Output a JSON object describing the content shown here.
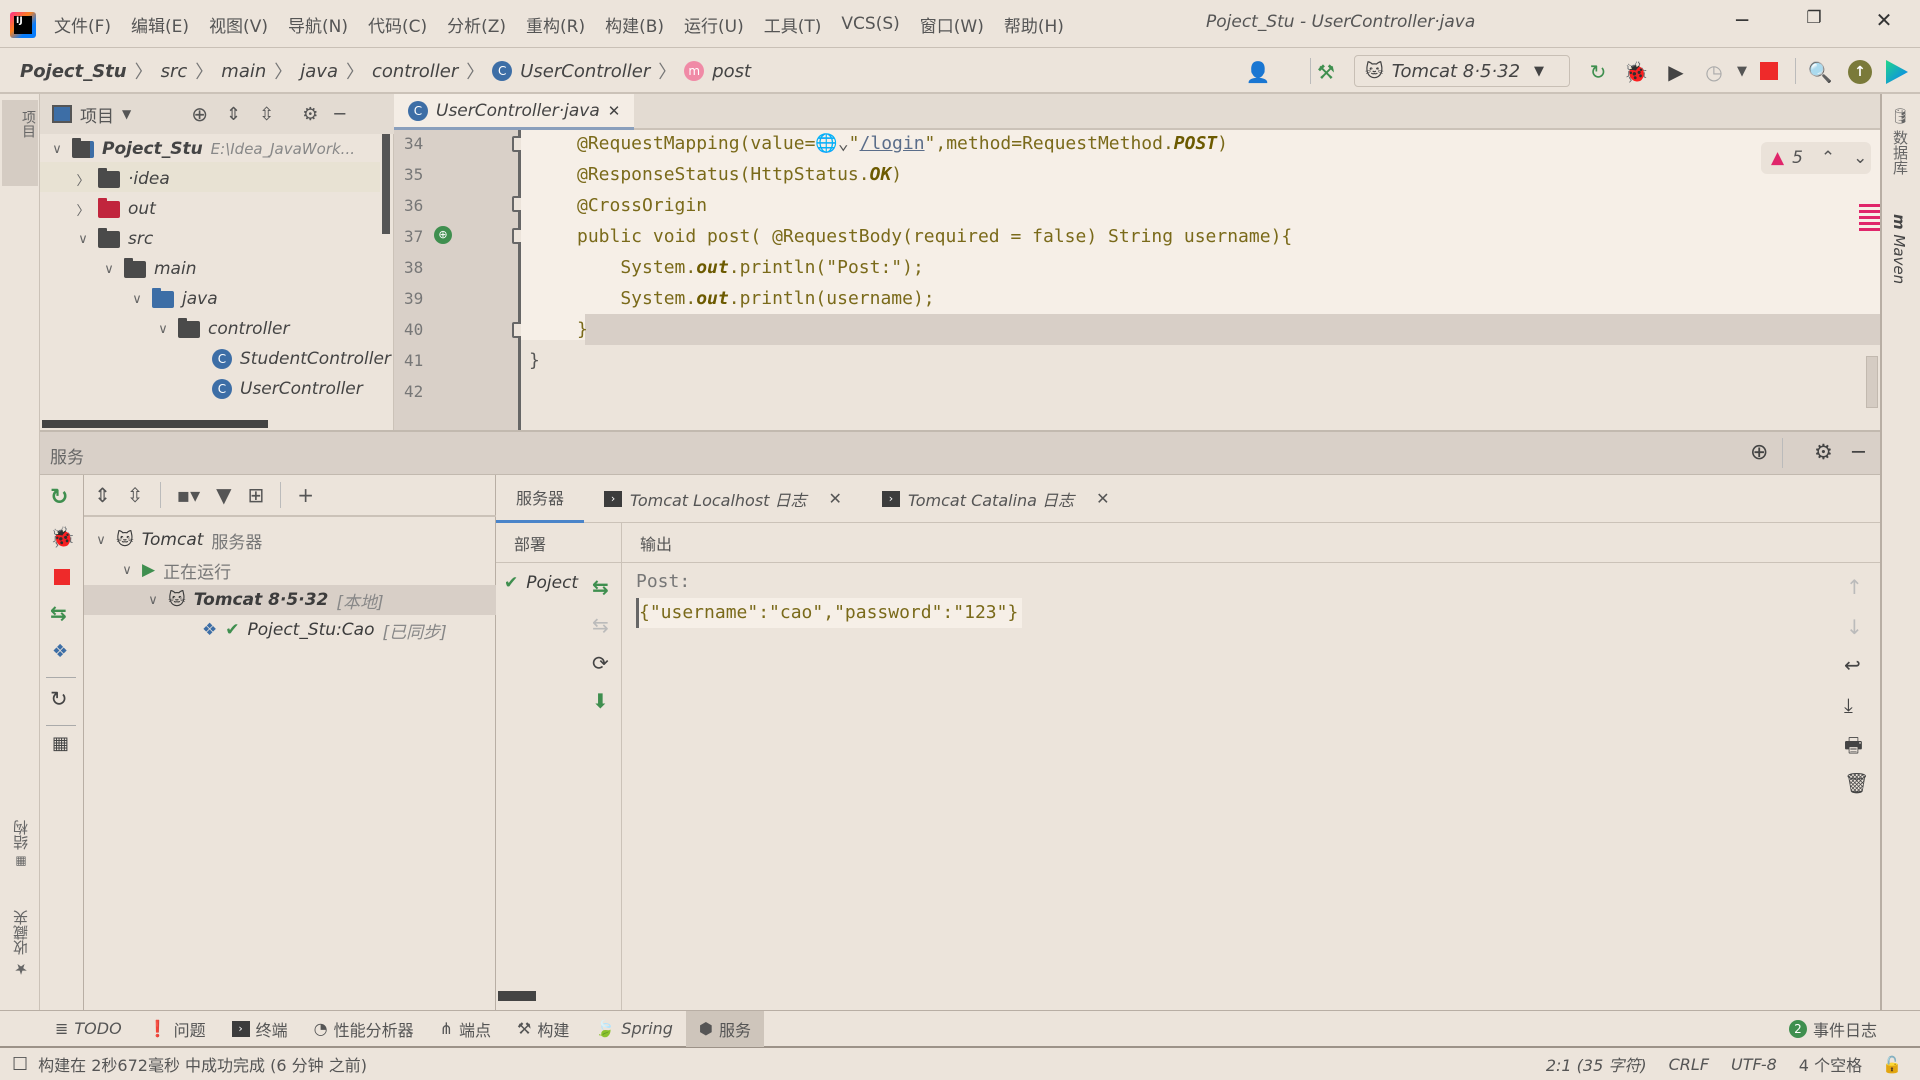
{
  "menu": [
    "文件(F)",
    "编辑(E)",
    "视图(V)",
    "导航(N)",
    "代码(C)",
    "分析(Z)",
    "重构(R)",
    "构建(B)",
    "运行(U)",
    "工具(T)",
    "VCS(S)",
    "窗口(W)",
    "帮助(H)"
  ],
  "window_title": "Poject_Stu - UserController·java",
  "breadcrumb": {
    "project": "Poject_Stu",
    "src": "src",
    "main": "main",
    "java": "java",
    "controller": "controller",
    "class": "UserController",
    "method": "post"
  },
  "run_config": "Tomcat 8·5·32",
  "left_strip": {
    "project": "项目",
    "structure": "结构",
    "favorites": "收藏夹"
  },
  "right_strip": {
    "database": "数据库",
    "maven": "Maven"
  },
  "project_panel": {
    "title": "项目",
    "tree": [
      {
        "label": "Poject_Stu",
        "path": "E:\\Idea_JavaWork..."
      },
      {
        "label": "·idea"
      },
      {
        "label": "out"
      },
      {
        "label": "src"
      },
      {
        "label": "main"
      },
      {
        "label": "java"
      },
      {
        "label": "controller"
      },
      {
        "label": "StudentController"
      },
      {
        "label": "UserController"
      }
    ]
  },
  "editor": {
    "tab": "UserController·java",
    "warnings": "5",
    "line_numbers": [
      "34",
      "35",
      "36",
      "37",
      "38",
      "39",
      "40",
      "41",
      "42"
    ],
    "lines": {
      "l34a": "@RequestMapping(value=",
      "l34b": "\"",
      "l34link": "/login",
      "l34c": "\",method=RequestMethod.",
      "l34d": "POST",
      "l34e": ")",
      "l35a": "@ResponseStatus(HttpStatus.",
      "l35b": "OK",
      "l35c": ")",
      "l36": "@CrossOrigin",
      "l37": "public void post( @RequestBody(required = false) String username){",
      "l38a": "    System.",
      "l38b": "out",
      "l38c": ".println(\"Post:\");",
      "l39a": "    System.",
      "l39b": "out",
      "l39c": ".println(username);",
      "l40": "}",
      "l41": "}"
    }
  },
  "services": {
    "title": "服务",
    "tree": {
      "root": "Tomcat",
      "root_suffix": "服务器",
      "running": "正在运行",
      "server": "Tomcat 8·5·32",
      "server_tag": "[本地]",
      "artifact": "Poject_Stu:Cao",
      "artifact_tag": "[已同步]"
    },
    "tabs": [
      {
        "label": "服务器"
      },
      {
        "label": "Tomcat Localhost 日志"
      },
      {
        "label": "Tomcat Catalina 日志"
      }
    ],
    "deploy_header": "部署",
    "deploy_item": "Poject",
    "output_header": "输出",
    "output": [
      "Post:",
      "{\"username\":\"cao\",\"password\":\"123\"}"
    ]
  },
  "bottom_tabs": [
    {
      "label": "TODO"
    },
    {
      "label": "问题"
    },
    {
      "label": "终端"
    },
    {
      "label": "性能分析器"
    },
    {
      "label": "端点"
    },
    {
      "label": "构建"
    },
    {
      "label": "Spring"
    },
    {
      "label": "服务"
    }
  ],
  "event_log": {
    "count": "2",
    "label": "事件日志"
  },
  "status": {
    "message": "构建在 2秒672毫秒 中成功完成 (6 分钟 之前)",
    "position": "2:1 (35 字符)",
    "line_sep": "CRLF",
    "encoding": "UTF-8",
    "indent": "4 个空格"
  },
  "colors": {
    "accent": "#4a84c9",
    "error": "#e0266b",
    "run_green": "#3f8f4f",
    "stop_red": "#ee2a2a"
  }
}
